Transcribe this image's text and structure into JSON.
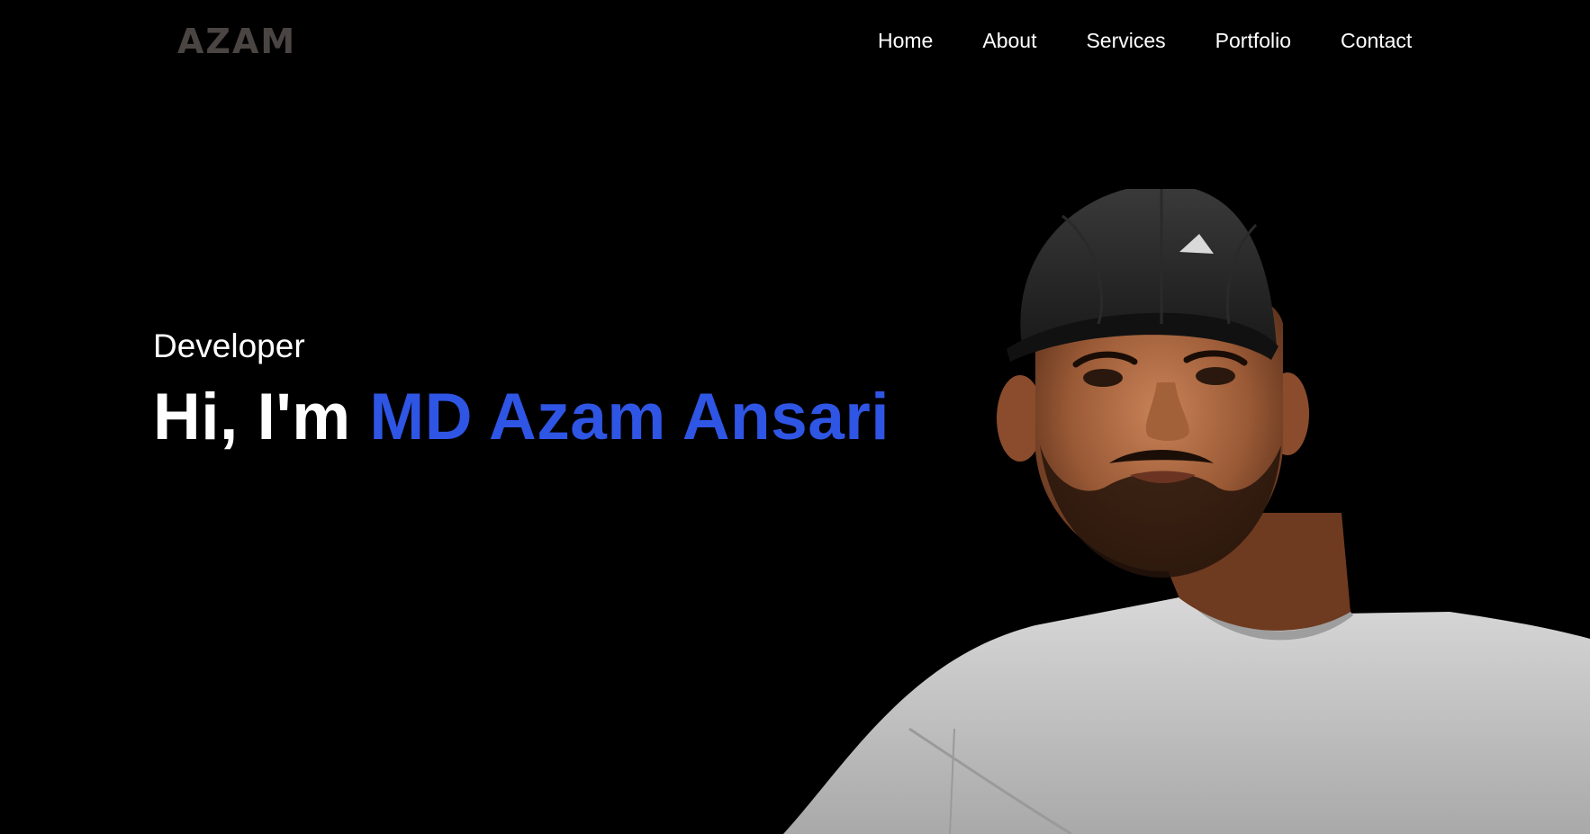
{
  "header": {
    "logo_text": "AZAM",
    "nav": [
      {
        "label": "Home"
      },
      {
        "label": "About"
      },
      {
        "label": "Services"
      },
      {
        "label": "Portfolio"
      },
      {
        "label": "Contact"
      }
    ]
  },
  "hero": {
    "role": "Developer",
    "greeting": "Hi, I'm",
    "name": "MD Azam Ansari"
  },
  "colors": {
    "background": "#000000",
    "accent": "#2f55e4",
    "logo": "#4a4543",
    "text": "#ffffff"
  },
  "portrait": {
    "icon": "profile-photo-icon"
  }
}
